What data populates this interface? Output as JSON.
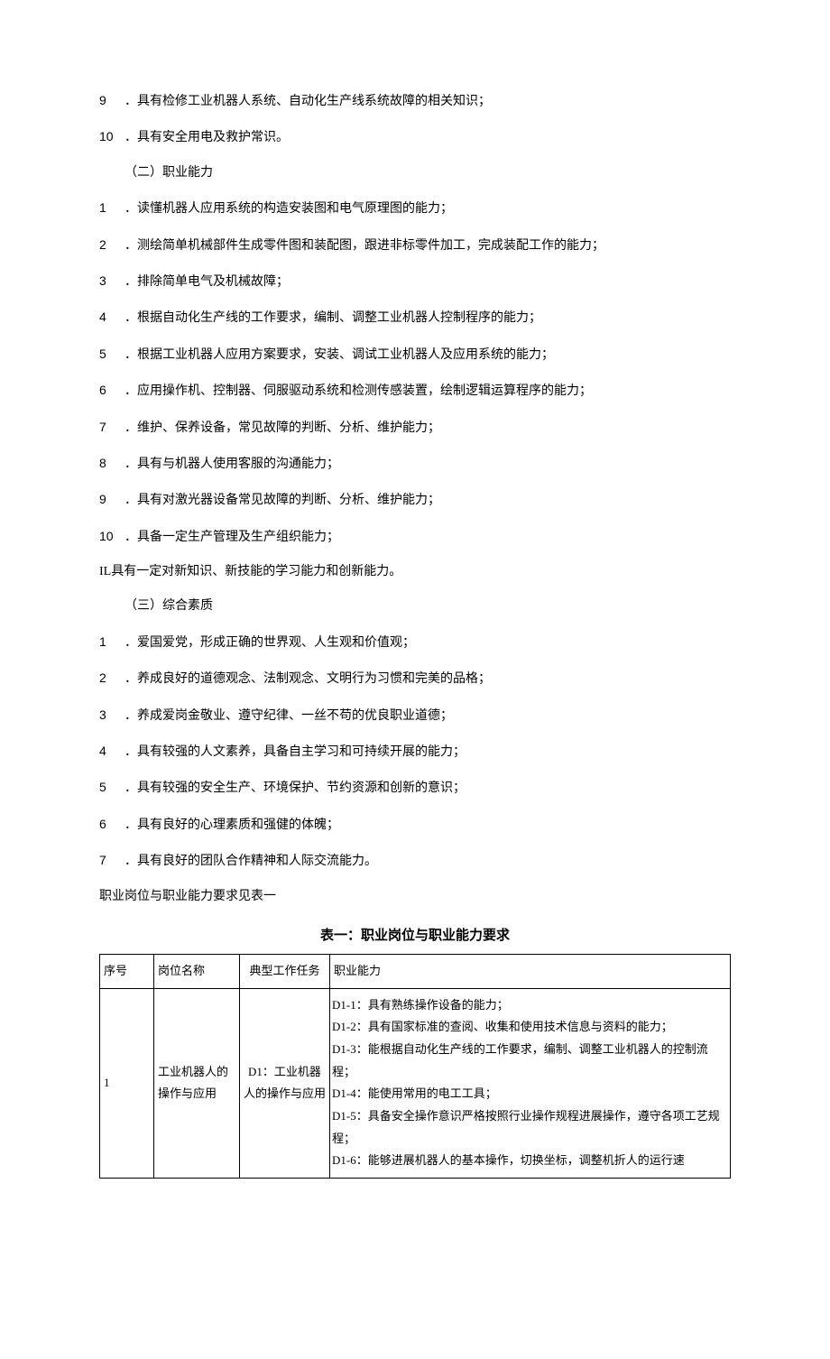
{
  "list1": [
    {
      "num": "9",
      "text": "．具有检修工业机器人系统、自动化生产线系统故障的相关知识；"
    },
    {
      "num": "10",
      "text": "．具有安全用电及救护常识。"
    }
  ],
  "section2": "（二）职业能力",
  "list2": [
    {
      "num": "1",
      "text": "．读懂机器人应用系统的构造安装图和电气原理图的能力；"
    },
    {
      "num": "2",
      "text": "．测绘简单机械部件生成零件图和装配图，跟进非标零件加工，完成装配工作的能力；"
    },
    {
      "num": "3",
      "text": "．排除简单电气及机械故障；"
    },
    {
      "num": "4",
      "text": "．根据自动化生产线的工作要求，编制、调整工业机器人控制程序的能力；"
    },
    {
      "num": "5",
      "text": "．根据工业机器人应用方案要求，安装、调试工业机器人及应用系统的能力；"
    },
    {
      "num": "6",
      "text": "．应用操作机、控制器、伺服驱动系统和检测传感装置，绘制逻辑运算程序的能力；"
    },
    {
      "num": "7",
      "text": "．维护、保养设备，常见故障的判断、分析、维护能力；"
    },
    {
      "num": "8",
      "text": "．具有与机器人使用客服的沟通能力；"
    },
    {
      "num": "9",
      "text": "．具有对激光器设备常见故障的判断、分析、维护能力；"
    },
    {
      "num": "10",
      "text": "．具备一定生产管理及生产组织能力；"
    }
  ],
  "special_il": "IL具有一定对新知识、新技能的学习能力和创新能力。",
  "section3": "（三）综合素质",
  "list3": [
    {
      "num": "1",
      "text": "．爱国爱党，形成正确的世界观、人生观和价值观；"
    },
    {
      "num": "2",
      "text": "．养成良好的道德观念、法制观念、文明行为习惯和完美的品格；"
    },
    {
      "num": "3",
      "text": "．养成爱岗金敬业、遵守纪律、一丝不苟的优良职业道德；"
    },
    {
      "num": "4",
      "text": "．具有较强的人文素养，具备自主学习和可持续开展的能力；"
    },
    {
      "num": "5",
      "text": "．具有较强的安全生产、环境保护、节约资源和创新的意识；"
    },
    {
      "num": "6",
      "text": "．具有良好的心理素质和强健的体魄；"
    },
    {
      "num": "7",
      "text": "．具有良好的团队合作精神和人际交流能力。"
    }
  ],
  "table_note": "职业岗位与职业能力要求见表一",
  "table_title": "表一：职业岗位与职业能力要求",
  "table": {
    "headers": {
      "seq": "序号",
      "position": "岗位名称",
      "task": "典型工作任务",
      "ability": "职业能力"
    },
    "rows": [
      {
        "seq": "1",
        "position": "工业机器人的操作与应用",
        "task": "D1：工业机器人的操作与应用",
        "abilities": [
          "D1-1：具有熟练操作设备的能力；",
          "D1-2：具有国家标准的查阅、收集和使用技术信息与资料的能力；",
          "D1-3：能根据自动化生产线的工作要求，编制、调整工业机器人的控制流程；",
          "D1-4：能使用常用的电工工具；",
          "D1-5：具备安全操作意识严格按照行业操作规程进展操作，遵守各项工艺规程；",
          "D1-6：能够进展机器人的基本操作，切换坐标，调整机折人的运行速"
        ]
      }
    ]
  }
}
